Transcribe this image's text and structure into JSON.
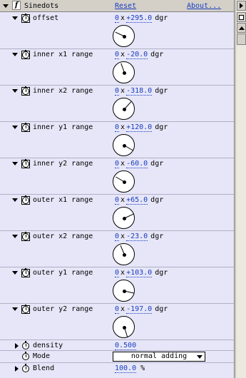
{
  "effect": {
    "name": "Sinedots",
    "reset_label": "Reset",
    "about_label": "About...",
    "fx_glyph": "f"
  },
  "params": [
    {
      "label": "offset",
      "revs": "0",
      "deg": "+295.0",
      "unit": "dgr",
      "angle": 295
    },
    {
      "label": "inner x1 range",
      "revs": "0",
      "deg": "-20.0",
      "unit": "dgr",
      "angle": -20
    },
    {
      "label": "inner x2 range",
      "revs": "0",
      "deg": "-318.0",
      "unit": "dgr",
      "angle": -318
    },
    {
      "label": "inner y1 range",
      "revs": "0",
      "deg": "+120.0",
      "unit": "dgr",
      "angle": 120
    },
    {
      "label": "inner y2 range",
      "revs": "0",
      "deg": "-60.0",
      "unit": "dgr",
      "angle": -60
    },
    {
      "label": "outer x1 range",
      "revs": "0",
      "deg": "+65.0",
      "unit": "dgr",
      "angle": 65
    },
    {
      "label": "outer x2 range",
      "revs": "0",
      "deg": "-23.0",
      "unit": "dgr",
      "angle": -23
    },
    {
      "label": "outer y1 range",
      "revs": "0",
      "deg": "+103.0",
      "unit": "dgr",
      "angle": 103
    },
    {
      "label": "outer y2 range",
      "revs": "0",
      "deg": "-197.0",
      "unit": "dgr",
      "angle": -197
    }
  ],
  "angle_separator": "x",
  "density": {
    "label": "density",
    "value": "0.500"
  },
  "mode": {
    "label": "Mode",
    "value": "normal adding"
  },
  "blend": {
    "label": "Blend",
    "value": "100.0",
    "unit": "%"
  }
}
